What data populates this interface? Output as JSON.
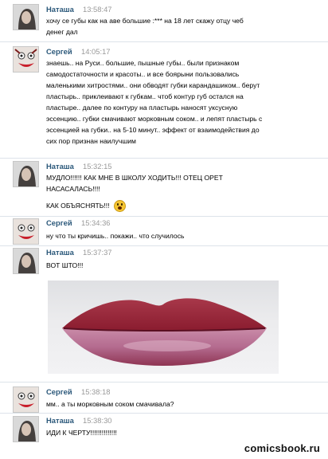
{
  "messages": [
    {
      "author": "Наташа",
      "time": "13:58:47",
      "lines": [
        "хочу се губы как на аве большие :*** на 18 лет скажу отцу чеб",
        "денег дал"
      ]
    },
    {
      "author": "Сергей",
      "time": "14:05:17",
      "lines": [
        "знаешь.. на Руси.. большие, пышные губы.. были признаком",
        "самодостаточности и красоты.. и все боярыни пользовались",
        "маленькими хитростями.. они обводят губки карандашиком.. берут",
        "пластырь.. приклеивают к губкам.. чтоб контур губ остался на",
        "пластыре.. далее по контуру на пластырь наносят уксусную",
        "эссенцию.. губки смачивают морковным соком.. и лепят пластырь с",
        "эссенцией на губки.. на 5-10 минут.. эффект от взаимодействия до",
        "сих пор признан наилучшим"
      ]
    },
    {
      "author": "Наташа",
      "time": "15:32:15",
      "lines": [
        "МУДЛО!!!!!! КАК МНЕ В ШКОЛУ ХОДИТЬ!!! ОТЕЦ ОРЕТ",
        "НАСАСАЛАСЬ!!!!",
        "КАК ОБЪЯСНЯТЬ!!!"
      ]
    },
    {
      "author": "Сергей",
      "time": "15:34:36",
      "lines": [
        "ну что ты кричишь.. покажи.. что случилось"
      ]
    },
    {
      "author": "Наташа",
      "time": "15:37:37",
      "lines": [
        "ВОТ ШТО!!!"
      ]
    },
    {
      "author": "Сергей",
      "time": "15:38:18",
      "lines": [
        "мм.. а ты морковным соком смачивала?"
      ]
    },
    {
      "author": "Наташа",
      "time": "15:38:30",
      "lines": [
        "ИДИ К ЧЕРТУ!!!!!!!!!!!!!!"
      ]
    }
  ],
  "watermark": "comicsbook.ru",
  "colors": {
    "author": "#2b587a",
    "time": "#999999"
  }
}
